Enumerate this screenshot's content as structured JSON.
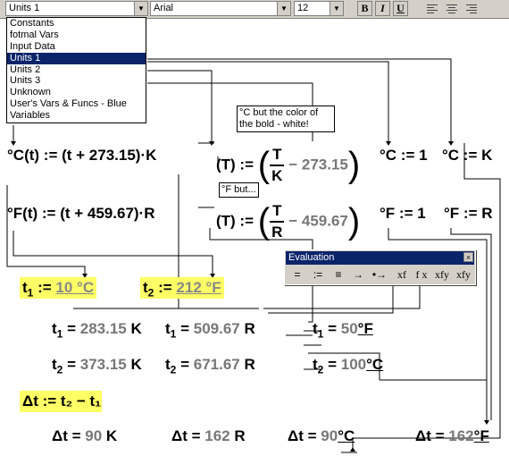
{
  "toolbar": {
    "style_value": "Units 1",
    "font_value": "Arial",
    "size_value": "12",
    "bold_label": "B",
    "italic_label": "I",
    "underline_label": "U"
  },
  "style_list": [
    "Constants",
    "fotmal Vars",
    "Input Data",
    "Units 1",
    "Units 2",
    "Units 3",
    "Unknown",
    "User's Vars & Funcs - Blue",
    "Variables"
  ],
  "notes": {
    "celsius_note": "°C but the color of the bold - white!",
    "fahr_note": "°F but..."
  },
  "eval_toolbar": {
    "title": "Evaluation",
    "close": "×",
    "buttons": [
      "=",
      ":=",
      "≡",
      "→",
      "•→",
      "xf",
      "f x",
      "xfy",
      "xfy"
    ]
  },
  "defs": {
    "c_fn": "°C(t) := (t + 273.15)·K",
    "f_fn": "°F(t) := (t + 459.67)·R",
    "blank_T": "(T) :=",
    "K": "K",
    "R": "R",
    "T": "T",
    "minus_c": "− 273.15",
    "minus_f": "− 459.67",
    "c_eq1": "°C := 1",
    "c_eqK": "°C := K",
    "f_eq1": "°F := 1",
    "f_eqR": "°F := R"
  },
  "inputs": {
    "t1_label": "t",
    "t1_sub": "1",
    "t1_assign": ":=",
    "t1_value": "10 °C",
    "t2_label": "t",
    "t2_sub": "2",
    "t2_assign": ":=",
    "t2_value": "212 °F"
  },
  "results": {
    "t1_K": "283.15",
    "t1_R": "509.67",
    "t1_F": "50",
    "t2_K": "373.15",
    "t2_R": "671.67",
    "t2_C": "100",
    "unit_K": "K",
    "unit_R": "R",
    "unit_F": "°F",
    "unit_C": "°C"
  },
  "delta": {
    "def": "Δt := t₂ − t₁",
    "K_val": "90",
    "R_val": "162",
    "C_val": "90",
    "F_val": "162"
  }
}
